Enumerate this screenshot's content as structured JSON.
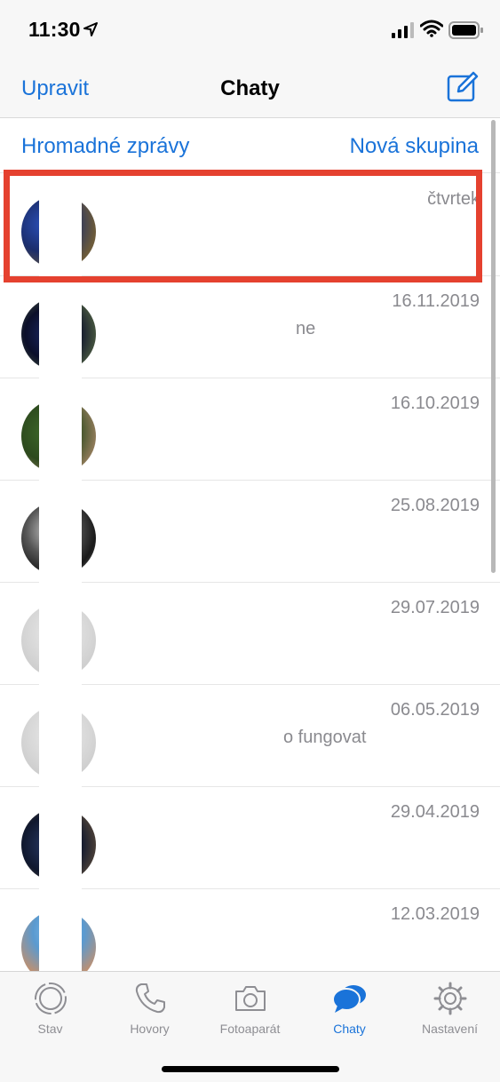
{
  "status_bar": {
    "time": "11:30",
    "icons": [
      "location-arrow-icon",
      "cellular-signal-icon",
      "wifi-icon",
      "battery-icon"
    ]
  },
  "nav": {
    "left_button": "Upravit",
    "title": "Chaty",
    "right_icon": "compose-icon"
  },
  "actions": {
    "broadcast": "Hromadné zprávy",
    "new_group": "Nová skupina"
  },
  "chats": [
    {
      "date": "čtvrtek",
      "preview": ""
    },
    {
      "date": "16.11.2019",
      "preview": "ne"
    },
    {
      "date": "16.10.2019",
      "preview": ""
    },
    {
      "date": "25.08.2019",
      "preview": ""
    },
    {
      "date": "29.07.2019",
      "preview": ""
    },
    {
      "date": "06.05.2019",
      "preview": "o fungovat"
    },
    {
      "date": "29.04.2019",
      "preview": ""
    },
    {
      "date": "12.03.2019",
      "preview": ""
    }
  ],
  "tabs": [
    {
      "label": "Stav",
      "icon": "status-icon",
      "active": false
    },
    {
      "label": "Hovory",
      "icon": "phone-icon",
      "active": false
    },
    {
      "label": "Fotoaparát",
      "icon": "camera-icon",
      "active": false
    },
    {
      "label": "Chaty",
      "icon": "chat-bubbles-icon",
      "active": true
    },
    {
      "label": "Nastavení",
      "icon": "gear-icon",
      "active": false
    }
  ],
  "colors": {
    "accent": "#1a73d9",
    "highlight": "#e5412f",
    "secondary_text": "#8a8a8f"
  }
}
